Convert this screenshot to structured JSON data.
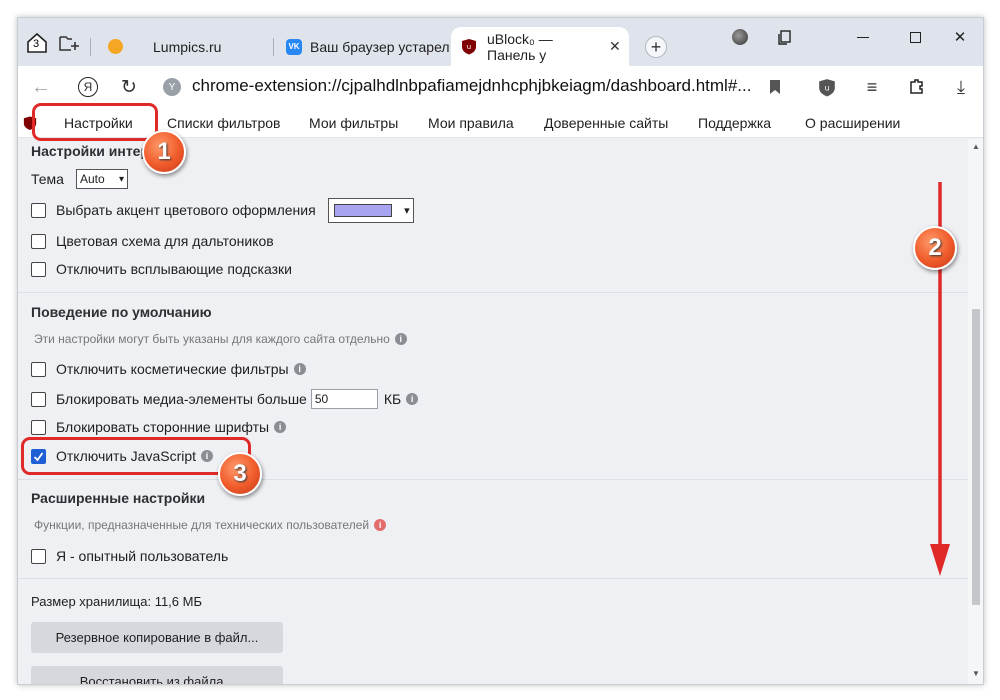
{
  "tabs": [
    {
      "label": "Lumpics.ru",
      "active": false
    },
    {
      "label": "Ваш браузер устарел",
      "active": false
    },
    {
      "label": "uBlock₀ — Панель у",
      "active": true
    }
  ],
  "tab_counter": "3",
  "url": "chrome-extension://cjpalhdlnbpafiamejdnhcphjbkeiagm/dashboard.html#...",
  "nav": [
    "Настройки",
    "Списки фильтров",
    "Мои фильтры",
    "Мои правила",
    "Доверенные сайты",
    "Поддержка",
    "О расширении"
  ],
  "appearance": {
    "title": "Настройки интер",
    "theme_label": "Тема",
    "theme_value": "Auto",
    "accent_label": "Выбрать акцент цветового оформления",
    "accent_color": "#a9a4f0",
    "colorblind_label": "Цветовая схема для дальтоников",
    "tooltips_label": "Отключить всплывающие подсказки"
  },
  "defaults": {
    "title": "Поведение по умолчанию",
    "hint": "Эти настройки могут быть указаны для каждого сайта отдельно",
    "cosmetic_label": "Отключить косметические фильтры",
    "media_label": "Блокировать медиа-элементы больше",
    "media_value": "50",
    "media_unit": "КБ",
    "fonts_label": "Блокировать сторонние шрифты",
    "js_label": "Отключить JavaScript",
    "js_checked": true
  },
  "advanced": {
    "title": "Расширенные настройки",
    "hint": "Функции, предназначенные для технических пользователей",
    "expert_label": "Я - опытный пользователь"
  },
  "storage": {
    "label": "Размер хранилища: 11,6 МБ",
    "backup_label": "Резервное копирование в файл...",
    "restore_label": "Восстановить из файла..."
  },
  "badges": [
    "1",
    "2",
    "3"
  ],
  "colors": {
    "accent_blue": "#1e5fd6",
    "callout_red": "#e02a2a",
    "badge_orange": "#f05a2a"
  }
}
